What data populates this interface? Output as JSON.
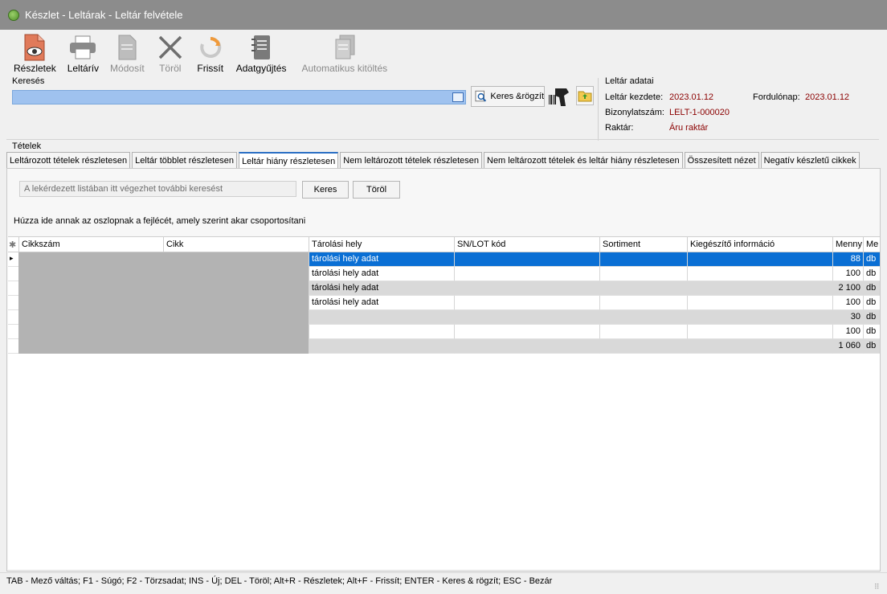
{
  "window": {
    "title": "Készlet - Leltárak - Leltár felvétele"
  },
  "toolbar": {
    "buttons": [
      {
        "label": "Részletek",
        "icon": "document-details-icon",
        "enabled": true
      },
      {
        "label": "Leltárív",
        "icon": "printer-icon",
        "enabled": true
      },
      {
        "label": "Módosít",
        "icon": "edit-document-icon",
        "enabled": false
      },
      {
        "label": "Töröl",
        "icon": "delete-x-icon",
        "enabled": false
      },
      {
        "label": "Frissít",
        "icon": "refresh-icon",
        "enabled": true
      },
      {
        "label": "Adatgyűjtés",
        "icon": "notebook-icon",
        "enabled": true
      },
      {
        "label": "Automatikus kitöltés",
        "icon": "autofill-icon",
        "enabled": false
      }
    ]
  },
  "search": {
    "label": "Keresés",
    "value": "",
    "search_record_label": "Keres &rögzít"
  },
  "leltar_adatai": {
    "title": "Leltár adatai",
    "start_label": "Leltár kezdete:",
    "start_value": "2023.01.12",
    "turnday_label": "Fordulónap:",
    "turnday_value": "2023.01.12",
    "doc_label": "Bizonylatszám:",
    "doc_value": "LELT-1-000020",
    "warehouse_label": "Raktár:",
    "warehouse_value": "Áru raktár"
  },
  "tetelek": {
    "label": "Tételek",
    "tabs": [
      "Leltározott tételek részletesen",
      "Leltár többlet részletesen",
      "Leltár hiány részletesen",
      "Nem leltározott tételek részletesen",
      "Nem leltározott tételek és leltár hiány részletesen",
      "Összesített nézet",
      "Negatív készletű cikkek"
    ],
    "active_tab": 2
  },
  "filter": {
    "placeholder": "A lekérdezett listában itt végezhet további keresést",
    "search_button": "Keres",
    "clear_button": "Töröl",
    "group_hint": "Húzza ide annak az oszlopnak a fejlécét, amely szerint akar csoportosítani"
  },
  "grid": {
    "columns": [
      "Cikkszám",
      "Cikk",
      "Tárolási hely",
      "SN/LOT kód",
      "Sortiment",
      "Kiegészítő információ",
      "Menny",
      "Me"
    ],
    "rows": [
      {
        "hely": "tárolási hely adat",
        "menny": "88",
        "me": "db",
        "selected": true,
        "shaded": false
      },
      {
        "hely": "tárolási hely adat",
        "menny": "100",
        "me": "db",
        "selected": false,
        "shaded": false
      },
      {
        "hely": "tárolási hely adat",
        "menny": "2 100",
        "me": "db",
        "selected": false,
        "shaded": true
      },
      {
        "hely": "tárolási hely adat",
        "menny": "100",
        "me": "db",
        "selected": false,
        "shaded": false
      },
      {
        "hely": "",
        "menny": "30",
        "me": "db",
        "selected": false,
        "shaded": true
      },
      {
        "hely": "",
        "menny": "100",
        "me": "db",
        "selected": false,
        "shaded": false
      },
      {
        "hely": "",
        "menny": "1 060",
        "me": "db",
        "selected": false,
        "shaded": true
      }
    ],
    "colors": {
      "selected": "#0a6fd4",
      "shaded": "#d9d9d9",
      "masked": "#b3b3b3"
    }
  },
  "statusbar": {
    "text": "TAB - Mező váltás; F1 - Súgó; F2 - Törzsadat; INS - Új; DEL - Töröl; Alt+R - Részletek; Alt+F - Frissít; ENTER - Keres & rögzít; ESC - Bezár"
  }
}
